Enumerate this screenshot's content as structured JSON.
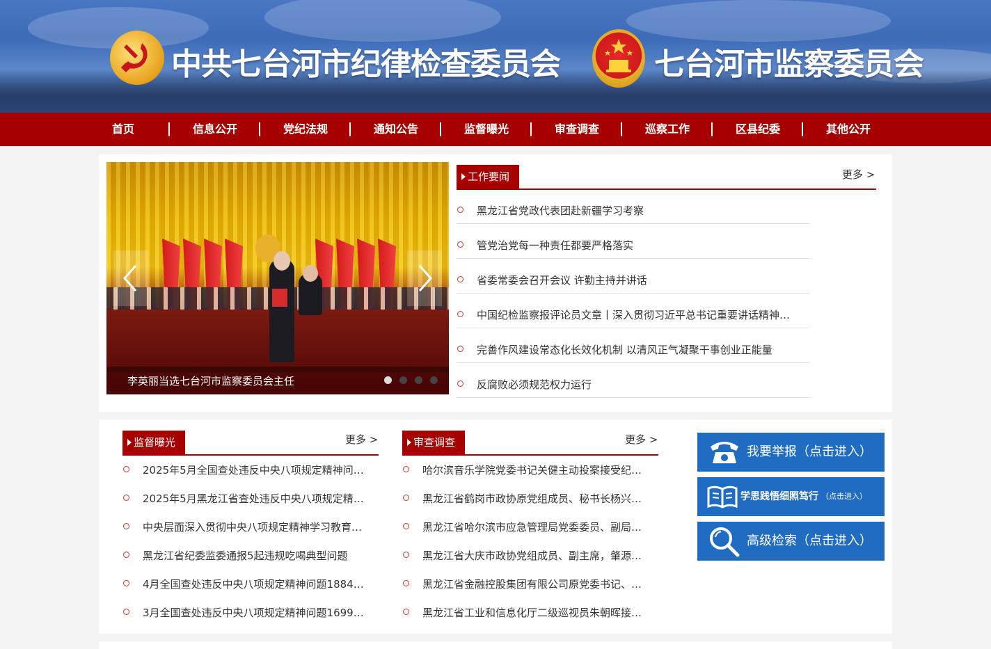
{
  "header": {
    "title_left": "中共七台河市纪律检查委员会",
    "title_right": "七台河市监察委员会"
  },
  "nav": [
    "首页",
    "信息公开",
    "党纪法规",
    "通知公告",
    "监督曝光",
    "审查调查",
    "巡察工作",
    "区县纪委",
    "其他公开"
  ],
  "slider": {
    "caption": "李英丽当选七台河市监察委员会主任",
    "prev_glyph": "‹",
    "next_glyph": "›"
  },
  "work_news": {
    "title": "工作要闻",
    "more": "更多 >",
    "items": [
      "黑龙江省党政代表团赴新疆学习考察",
      "管党治党每一种责任都要严格落实",
      "省委常委会召开会议 许勤主持并讲话",
      "中国纪检监察报评论员文章丨深入贯彻习近平总书记重要讲话精神…",
      "完善作风建设常态化长效化机制 以清风正气凝聚干事创业正能量",
      "反腐败必须规范权力运行"
    ]
  },
  "supervision": {
    "title": "监督曝光",
    "more": "更多 >",
    "items": [
      "2025年5月全国查处违反中央八项规定精神问…",
      "2025年5月黑龙江省查处违反中央八项规定精…",
      "中央层面深入贯彻中央八项规定精神学习教育…",
      "黑龙江省纪委监委通报5起违规吃喝典型问题",
      "4月全国查处违反中央八项规定精神问题1884…",
      "3月全国查处违反中央八项规定精神问题1699…"
    ]
  },
  "investigation": {
    "title": "审查调查",
    "more": "更多 >",
    "items": [
      "哈尔滨音乐学院党委书记关健主动投案接受纪…",
      "黑龙江省鹤岗市政协原党组成员、秘书长杨兴…",
      "黑龙江省哈尔滨市应急管理局党委委员、副局…",
      "黑龙江省大庆市政协党组成员、副主席，肇源…",
      "黑龙江省金融控股集团有限公司原党委书记、…",
      "黑龙江省工业和信息化厅二级巡视员朱朝晖接…"
    ]
  },
  "side_buttons": [
    {
      "label": "我要举报（点击进入）",
      "icon": "phone-icon"
    },
    {
      "label": "学思践悟细照笃行",
      "sub": "（点击进入）",
      "icon": "book-icon"
    },
    {
      "label": "高级检索（点击进入）",
      "icon": "search-icon"
    }
  ],
  "colors": {
    "nav_red": "#a60000",
    "button_blue": "#1f6cc2",
    "bullet": "#c0392b"
  }
}
